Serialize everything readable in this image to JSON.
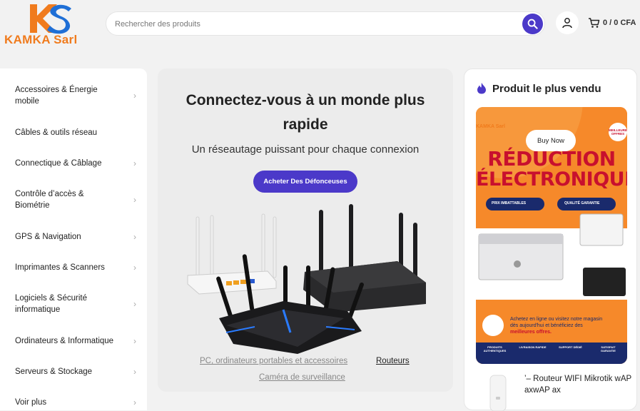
{
  "header": {
    "logo_text": "KAMKA Sarl",
    "search_placeholder": "Rechercher des produits",
    "cart_label": "0 / 0 CFA"
  },
  "sidebar": {
    "items": [
      {
        "label": "Accessoires & Énergie mobile",
        "has_arrow": true
      },
      {
        "label": "Câbles & outils réseau",
        "has_arrow": false
      },
      {
        "label": "Connectique & Câblage",
        "has_arrow": true
      },
      {
        "label": "Contrôle d’accès & Biométrie",
        "has_arrow": true
      },
      {
        "label": "GPS & Navigation",
        "has_arrow": true
      },
      {
        "label": "Imprimantes & Scanners",
        "has_arrow": true
      },
      {
        "label": "Logiciels & Sécurité informatique",
        "has_arrow": true
      },
      {
        "label": "Ordinateurs & Informatique",
        "has_arrow": true
      },
      {
        "label": "Serveurs & Stockage",
        "has_arrow": true
      },
      {
        "label": "Voir plus",
        "has_arrow": true
      }
    ]
  },
  "hero": {
    "title": "Connectez-vous à un monde plus rapide",
    "subtitle": "Un réseautage puissant pour chaque connexion",
    "button_label": "Acheter Des Défonceuses",
    "links": [
      {
        "label": "PC, ordinateurs portables et accessoires",
        "active": false
      },
      {
        "label": "Routeurs",
        "active": true
      },
      {
        "label": "Caméra de surveillance",
        "active": false
      }
    ]
  },
  "bestseller": {
    "title": "Produit le plus vendu",
    "banner": {
      "buy_now": "Buy Now",
      "logo_text": "KAMKA Sarl",
      "line1": "RÉDUCTION",
      "line2": "ÉLECTRONIQUE",
      "badge1": "PRIX IMBATTABLES",
      "badge2": "QUALITÉ GARANTIE",
      "corner": "MEILLEURES OFFRES",
      "promo_text_1": "Achetez en ligne ou visitez notre magasin dès aujourd'hui et bénéficiez des ",
      "promo_text_2": "meilleures offres.",
      "features": [
        "PRODUITS AUTHENTIQUES",
        "LIVRAISON RAPIDE",
        "SUPPORT DÉDIÉ",
        "SATISFAIT GARANTIE"
      ]
    },
    "product_name": "’– Routeur WIFI Mikrotik wAP axwAP ax"
  },
  "colors": {
    "accent": "#4b39c9",
    "logo_orange": "#f07b1d",
    "logo_blue": "#1f6fd6",
    "banner_orange": "#f6892a",
    "banner_red": "#c8102e"
  }
}
